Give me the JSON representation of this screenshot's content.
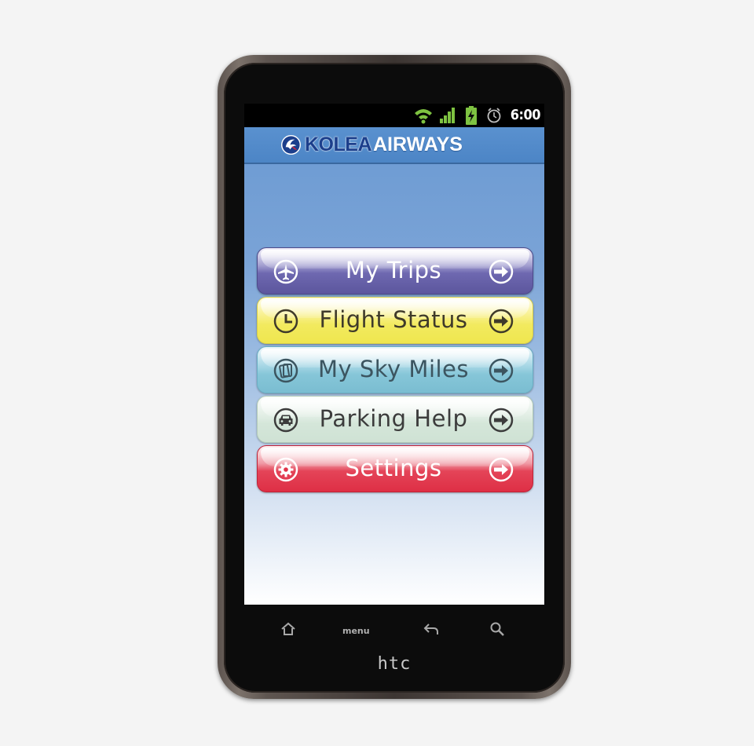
{
  "status_bar": {
    "time": "6:00",
    "icons": [
      "wifi-icon",
      "signal-icon",
      "battery-charging-icon",
      "alarm-icon"
    ],
    "icon_color": "#7ec241"
  },
  "header": {
    "logo_part1": "KOLEA",
    "logo_part2": "AIRWAYS",
    "background": "#4f88c9"
  },
  "menu": {
    "items": [
      {
        "label": "My Trips",
        "icon": "airplane-icon",
        "color": "#625ca5"
      },
      {
        "label": "Flight Status",
        "icon": "clock-icon",
        "color": "#f3ea5c"
      },
      {
        "label": "My Sky Miles",
        "icon": "card-icon",
        "color": "#86c6d8"
      },
      {
        "label": "Parking Help",
        "icon": "car-icon",
        "color": "#d3e5d8"
      },
      {
        "label": "Settings",
        "icon": "gear-icon",
        "color": "#e03348"
      }
    ],
    "arrow_icon": "arrow-right-icon"
  },
  "device": {
    "keys": [
      "home-icon",
      "menu",
      "back-icon",
      "search-icon"
    ],
    "menu_key_label": "menu",
    "brand": "htc"
  }
}
